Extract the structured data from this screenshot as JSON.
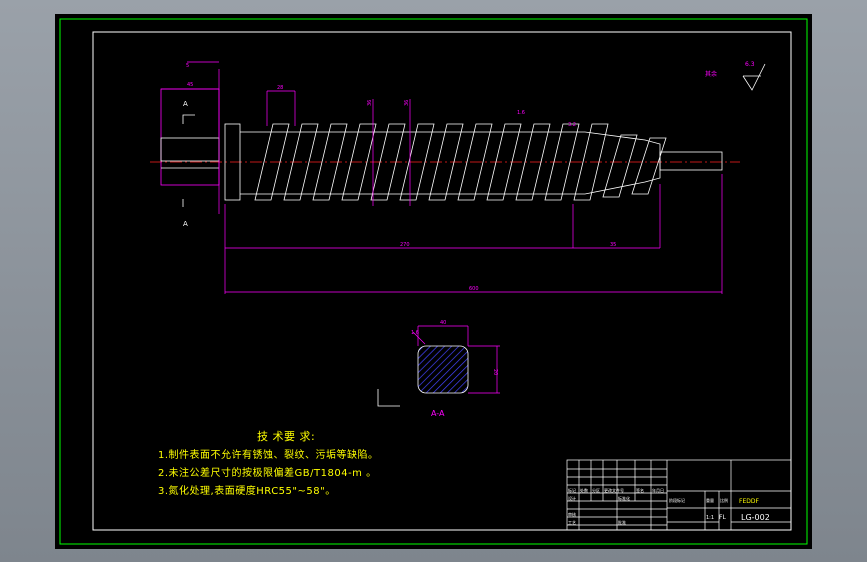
{
  "drawing": {
    "dims": {
      "d_left_top": "5",
      "d_left_width": "45",
      "d_pitch": "28",
      "d_mid_a": "36",
      "d_mid_b": "36",
      "d_flank": "1.6",
      "d_flank2": "3.2",
      "d_length_main": "270",
      "d_length_tail": "35",
      "d_total": "600",
      "d_section_w": "40",
      "d_section_h": "20",
      "d_section_rough": "1.6"
    },
    "section_labels": {
      "cut_top": "A",
      "cut_bottom": "A",
      "section_title": "A-A"
    },
    "surface_note": {
      "label": "其余",
      "roughness": "6.3"
    }
  },
  "requirements": {
    "title": "技 术要 求:",
    "items": [
      "1.制件表面不允许有锈蚀、裂纹、污垢等缺陷。",
      "2.未注公差尺寸的按极限偏差GB/T1804-m 。",
      "3.氮化处理,表面硬度HRC55\"~58\"。"
    ]
  },
  "title_block": {
    "drawing_no": "LG-002",
    "scale_char": "1:1",
    "short_label": "FL",
    "top_chars": "FEDDF",
    "mini_labels": [
      "标记",
      "处数",
      "分区",
      "更改文件号",
      "签名",
      "年月日"
    ],
    "mini_labels_2": [
      "设计",
      "标准化",
      "阶段标记",
      "重量",
      "比例"
    ],
    "mini_labels_3": [
      "审核",
      "工艺",
      "批准"
    ]
  },
  "colors": {
    "border_green": "#00ff00",
    "frame_white": "#ffffff",
    "part_white": "#ffffff",
    "dim_magenta": "#ff00ff",
    "centerline_red": "#ff2020",
    "hatch_blue": "#4444ff",
    "text_yellow": "#ffff00"
  }
}
